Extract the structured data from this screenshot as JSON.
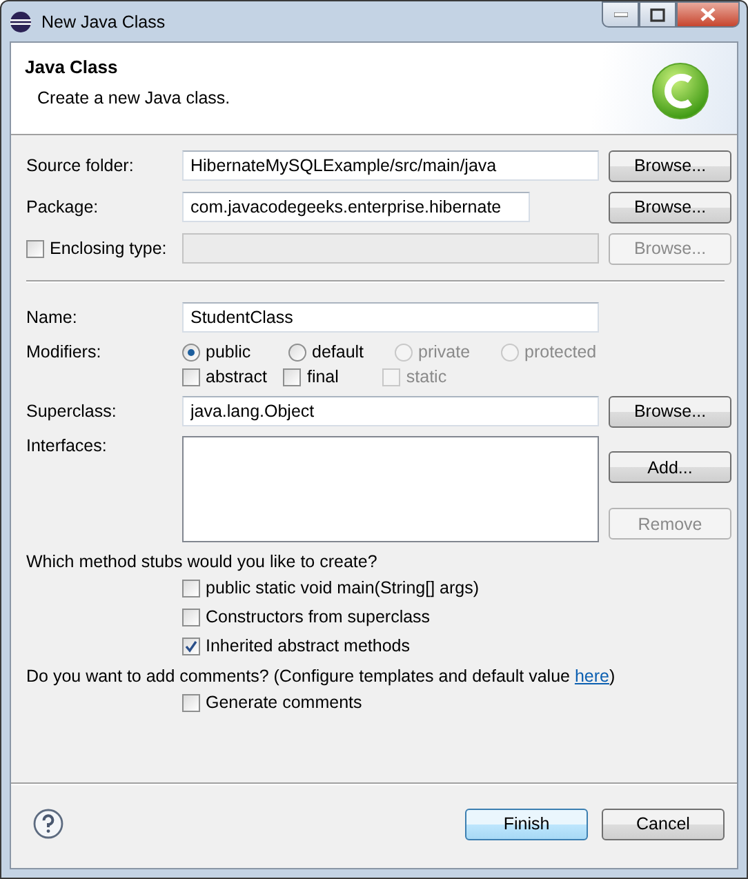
{
  "window": {
    "title": "New Java Class"
  },
  "header": {
    "title": "Java Class",
    "description": "Create a new Java class."
  },
  "fields": [
    {
      "kind": "text",
      "label": "Source folder:",
      "value": "HibernateMySQLExample/src/main/java",
      "wide": true,
      "button": {
        "label": "Browse...",
        "disabled": false
      }
    },
    {
      "kind": "text",
      "label": "Package:",
      "value": "com.javacodegeeks.enterprise.hibernate",
      "wide": false,
      "button": {
        "label": "Browse...",
        "disabled": false
      }
    },
    {
      "kind": "check",
      "label": "Enclosing type:",
      "checked": false,
      "value_disabled": true,
      "button": {
        "label": "Browse...",
        "disabled": true
      }
    }
  ],
  "name": {
    "label": "Name:",
    "value": "StudentClass"
  },
  "modifiers": {
    "label": "Modifiers:",
    "radios": [
      {
        "label": "public",
        "selected": true,
        "disabled": false
      },
      {
        "label": "default",
        "selected": false,
        "disabled": false
      },
      {
        "label": "private",
        "selected": false,
        "disabled": true
      },
      {
        "label": "protected",
        "selected": false,
        "disabled": true
      }
    ],
    "checkboxes": [
      {
        "label": "abstract",
        "checked": false,
        "disabled": false
      },
      {
        "label": "final",
        "checked": false,
        "disabled": false
      },
      {
        "label": "static",
        "checked": false,
        "disabled": true
      }
    ]
  },
  "superclass": {
    "label": "Superclass:",
    "value": "java.lang.Object",
    "button": {
      "label": "Browse...",
      "disabled": false
    }
  },
  "interfaces": {
    "label": "Interfaces:",
    "buttons": [
      {
        "label": "Add...",
        "disabled": false
      },
      {
        "label": "Remove",
        "disabled": true
      }
    ]
  },
  "stubs": {
    "prompt": "Which method stubs would you like to create?",
    "options": [
      {
        "label": "public static void main(String[] args)",
        "checked": false
      },
      {
        "label": "Constructors from superclass",
        "checked": false
      },
      {
        "label": "Inherited abstract methods",
        "checked": true
      }
    ]
  },
  "comments": {
    "prompt_before": "Do you want to add comments? (Configure templates and default value ",
    "link": "here",
    "prompt_after": ")",
    "option": {
      "label": "Generate comments",
      "checked": false
    }
  },
  "footer": {
    "buttons": [
      {
        "label": "Finish",
        "default": true
      },
      {
        "label": "Cancel",
        "default": false
      }
    ]
  }
}
